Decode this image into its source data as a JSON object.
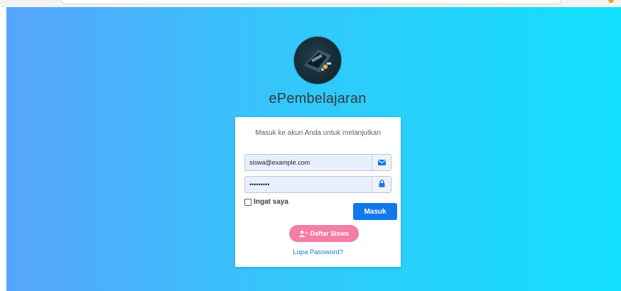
{
  "app": {
    "title": "ePembelajaran"
  },
  "login": {
    "subtitle": "Masuk ke akun Anda untuk melanjutkan",
    "email_value": "siswa@example.com",
    "password_value": "•••••••••",
    "remember_label": "Ingat saya",
    "submit_label": "Masuk",
    "register_label": "Daftar Siswa",
    "forgot_label": "Lupa Password?"
  },
  "icons": {
    "email": "envelope-icon",
    "password": "lock-icon",
    "register": "user-plus-icon"
  },
  "colors": {
    "gradient_start": "#58a4fb",
    "gradient_end": "#12e1fc",
    "primary": "#1178ec",
    "register": "#f47ea4",
    "link": "#1b7bd1"
  }
}
